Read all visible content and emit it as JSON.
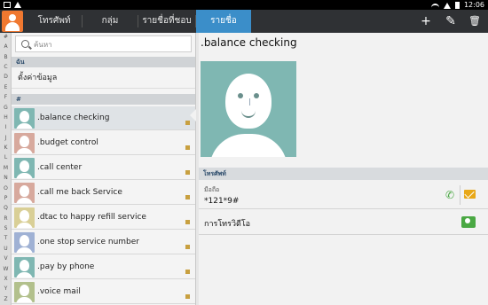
{
  "status_bar": {
    "time": "12:06"
  },
  "action_bar": {
    "tabs": [
      {
        "label": "โทรศัพท์"
      },
      {
        "label": "กลุ่ม"
      },
      {
        "label": "รายชื่อที่ชอบ"
      },
      {
        "label": "รายชื่อ",
        "active": true
      }
    ],
    "add_icon": "plus-icon",
    "edit_icon": "pencil-icon",
    "delete_icon": "trash-icon"
  },
  "index_letters": [
    "#",
    "A",
    "B",
    "C",
    "D",
    "E",
    "F",
    "G",
    "H",
    "I",
    "J",
    "K",
    "L",
    "M",
    "N",
    "O",
    "P",
    "Q",
    "R",
    "S",
    "T",
    "U",
    "V",
    "W",
    "X",
    "Y",
    "Z"
  ],
  "search": {
    "placeholder": "ค้นหา"
  },
  "me_section": {
    "header": "ฉัน",
    "item": "ตั้งค่าข้อมูล"
  },
  "contacts_section": {
    "header": "#"
  },
  "contacts": [
    {
      "name": ".balance checking",
      "color": "#7fb7b2",
      "selected": true
    },
    {
      "name": ".budget control",
      "color": "#d7a99d"
    },
    {
      "name": ".call center",
      "color": "#7fb7b2"
    },
    {
      "name": ".call me back Service",
      "color": "#d7a99d"
    },
    {
      "name": ".dtac to happy refill service",
      "color": "#d9cf96"
    },
    {
      "name": ".one stop service number",
      "color": "#9fb1d4"
    },
    {
      "name": ".pay by phone",
      "color": "#7fb7b2"
    },
    {
      "name": ".voice mail",
      "color": "#b2c08c"
    }
  ],
  "detail": {
    "title": ".balance checking",
    "section_header": "โทรศัพท์",
    "phone_type": "มือถือ",
    "phone_number": "*121*9#",
    "video_call_label": "การโทรวิดีโอ"
  }
}
